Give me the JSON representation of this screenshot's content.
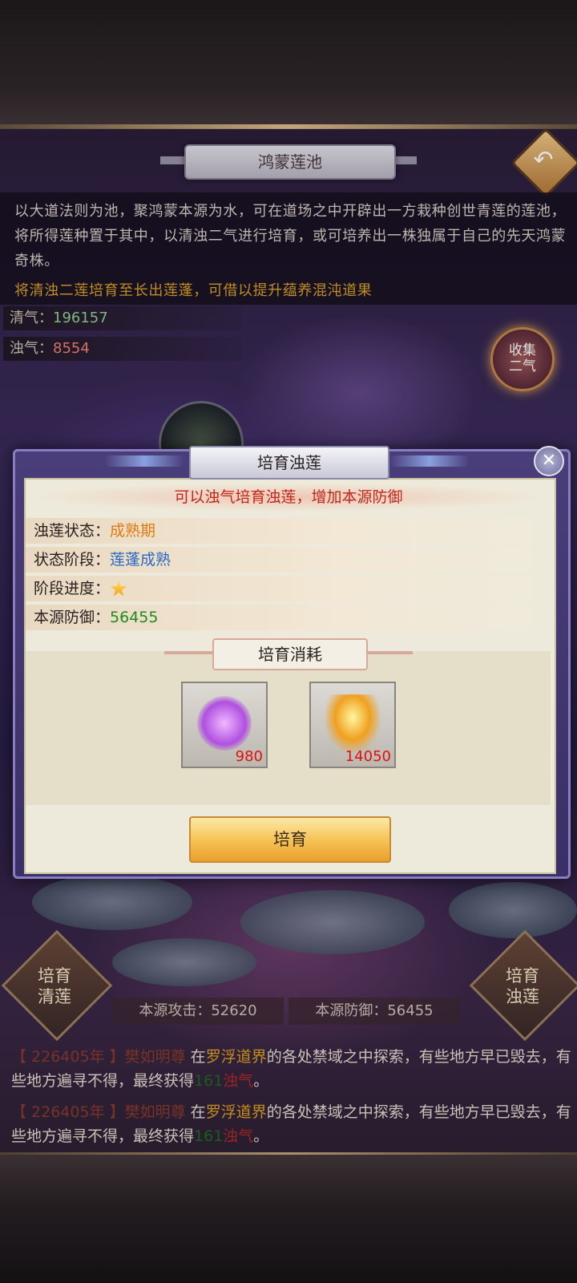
{
  "header": {
    "title": "鸿蒙莲池",
    "back_icon": "return-arrow-icon"
  },
  "description": {
    "text": "以大道法则为池，聚鸿蒙本源为水，可在道场之中开辟出一方栽种创世青莲的莲池，将所得莲种置于其中，以清浊二气进行培育，或可培养出一株独属于自己的先天鸿蒙奇株。",
    "hint": "将清浊二莲培育至长出莲蓬，可借以提升蕴养混沌道果"
  },
  "resources": {
    "clear": {
      "label": "清气：",
      "value": "196157"
    },
    "turbid": {
      "label": "浊气：",
      "value": "8554"
    }
  },
  "collect_button": {
    "line1": "收集",
    "line2": "二气"
  },
  "side_buttons": {
    "left": {
      "line1": "培育",
      "line2": "清莲"
    },
    "right": {
      "line1": "培育",
      "line2": "浊莲"
    }
  },
  "stats": {
    "attack": "本源攻击：52620",
    "defense": "本源防御：56455"
  },
  "logs": [
    {
      "time": "【 226405年 】",
      "name": "樊如明尊",
      "pre": " 在",
      "place": "罗浮道界",
      "mid": "的各处禁域之中探索，有些地方早已毁去，有些地方遍寻不得，最终获得",
      "amount": "161",
      "res": "浊气",
      "end": "。"
    },
    {
      "time": "【 226405年 】",
      "name": "樊如明尊",
      "pre": " 在",
      "place": "罗浮道界",
      "mid": "的各处禁域之中探索，有些地方早已毁去，有些地方遍寻不得，最终获得",
      "amount": "161",
      "res": "浊气",
      "end": "。"
    }
  ],
  "modal": {
    "title": "培育浊莲",
    "banner": "可以浊气培育浊莲，增加本源防御",
    "rows": [
      {
        "label": "浊莲状态：",
        "value": "成熟期"
      },
      {
        "label": "状态阶段：",
        "value": "莲蓬成熟"
      },
      {
        "label": "阶段进度：",
        "stars": 1
      },
      {
        "label": "本源防御：",
        "value": "56455"
      }
    ],
    "cost_title": "培育消耗",
    "costs": [
      {
        "icon": "purple-mist-icon",
        "count": "980"
      },
      {
        "icon": "fire-lotus-icon",
        "count": "14050"
      }
    ],
    "action_label": "培育",
    "close_icon": "close-x-icon"
  },
  "colors": {
    "modal_frame": "#3a3068",
    "modal_inner": "#eeeadb",
    "banner_text": "#c0261a",
    "hint_gold": "#d8a020",
    "cost_count": "#e01010"
  }
}
